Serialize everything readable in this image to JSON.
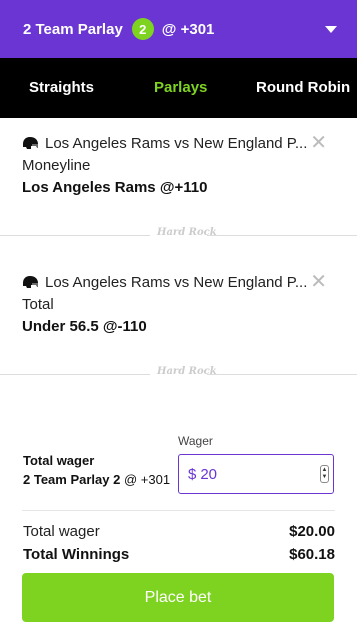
{
  "header": {
    "title": "2 Team Parlay",
    "count": "2",
    "odds": "@ +301"
  },
  "tabs": [
    {
      "label": "Straights"
    },
    {
      "label": "Parlays"
    },
    {
      "label": "Round Robin"
    }
  ],
  "selections": [
    {
      "title": "Los Angeles Rams vs New England P...",
      "market": "Moneyline",
      "pick": "Los Angeles Rams @+110",
      "icon": "helmet-icon"
    },
    {
      "title": "Los Angeles Rams vs New England P...",
      "market": "Total",
      "pick": "Under 56.5 @-110",
      "icon": "helmet-icon"
    }
  ],
  "divider_logo": "Hard Rock",
  "wager": {
    "field_label": "Wager",
    "title": "Total wager",
    "parlay_name": "2 Team Parlay 2",
    "parlay_odds": "@ +301",
    "currency": "$",
    "value": "20"
  },
  "summary": {
    "total_wager_label": "Total wager",
    "total_wager_value": "$20.00",
    "total_winnings_label": "Total Winnings",
    "total_winnings_value": "$60.18"
  },
  "place_bet_label": "Place bet",
  "colors": {
    "brand_purple": "#6a35d2",
    "accent_green": "#7ed321"
  }
}
